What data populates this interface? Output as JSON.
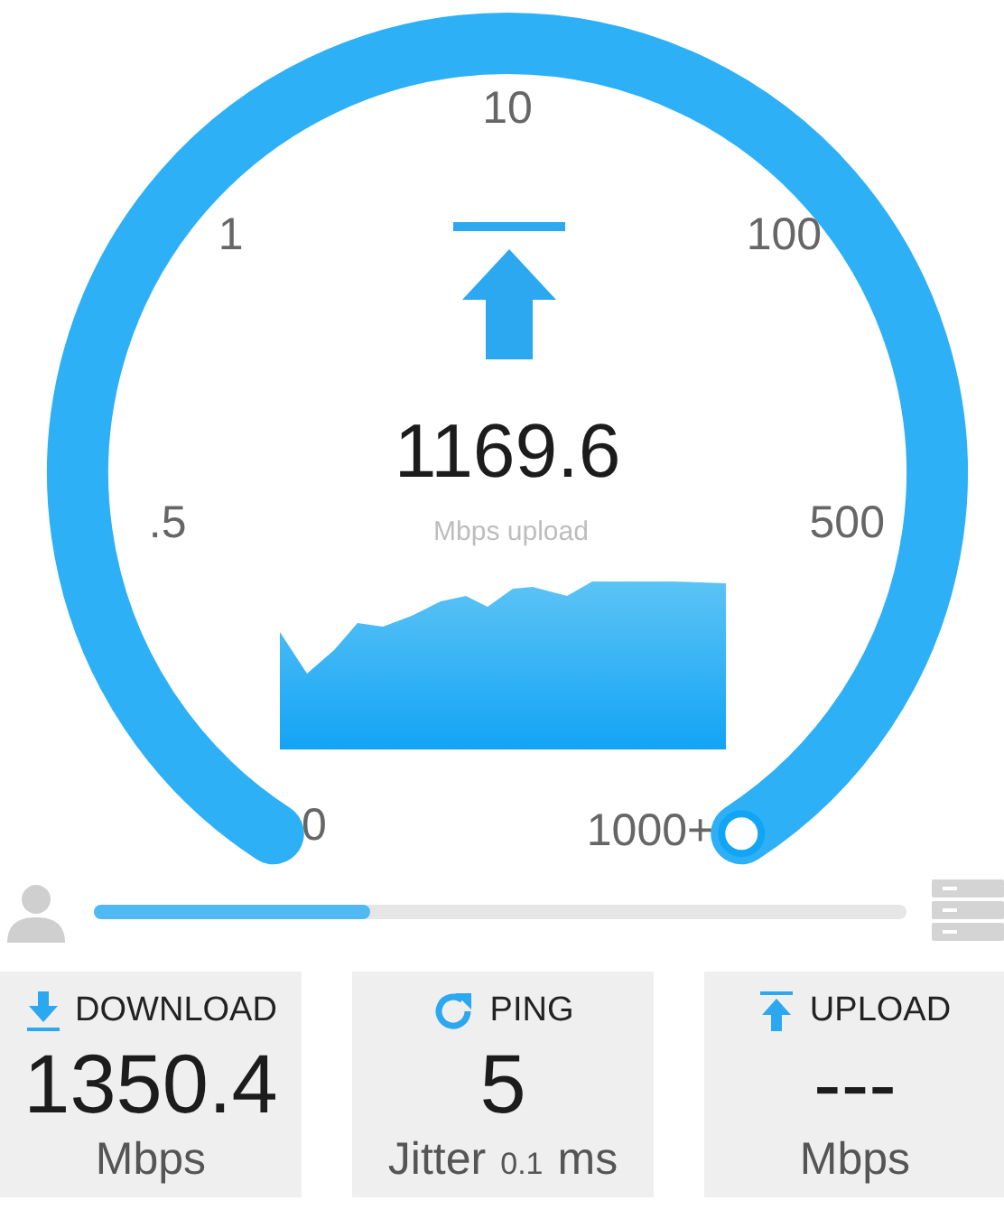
{
  "gauge": {
    "reading": "1169.6",
    "unit": "Mbps upload",
    "ticks": [
      "0",
      ".5",
      "1",
      "10",
      "100",
      "500",
      "1000+"
    ]
  },
  "progress": {
    "level": 0.34
  },
  "results": [
    {
      "kind": "download",
      "label": "DOWNLOAD",
      "value": "1350.4",
      "unit": "Mbps"
    },
    {
      "kind": "ping",
      "label": "PING",
      "value": "5",
      "sub_label": "Jitter",
      "sub_value": "0.1",
      "unit": "ms"
    },
    {
      "kind": "upload",
      "label": "UPLOAD",
      "value": "---",
      "unit": "Mbps"
    }
  ]
}
